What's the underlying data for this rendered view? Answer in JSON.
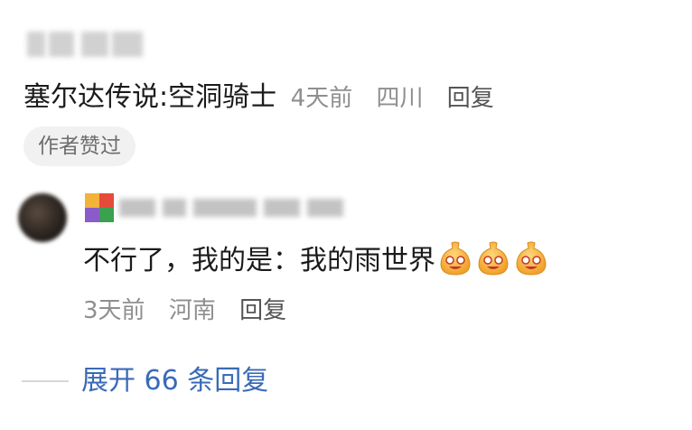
{
  "comment": {
    "text": "塞尔达传说:空洞骑士",
    "time": "4天前",
    "location": "四川",
    "reply_label": "回复",
    "badge": "作者赞过"
  },
  "reply": {
    "text": "不行了，我的是：我的雨世界",
    "emoji_icons": [
      "gourd-smile-icon",
      "gourd-smile-icon",
      "gourd-smile-icon"
    ],
    "time": "3天前",
    "location": "河南",
    "reply_label": "回复"
  },
  "expand": {
    "label": "展开 66 条回复"
  },
  "colors": {
    "text": "#1b1b1b",
    "meta": "#8f8f8f",
    "link": "#3a6ab8",
    "badge_bg": "#f1f1f1"
  }
}
